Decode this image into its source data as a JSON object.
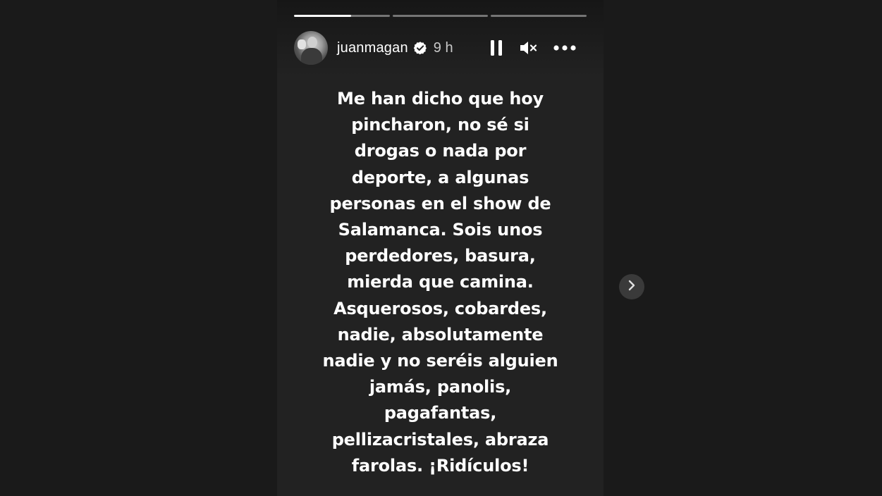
{
  "story": {
    "progress": [
      0.6,
      0,
      0
    ],
    "user": {
      "username": "juanmagan",
      "verified": true,
      "time": "9 h"
    },
    "controls": {
      "pause_icon": "pause-icon",
      "mute_icon": "speaker-muted-icon",
      "more_icon": "more-options-icon"
    },
    "caption": "Me han dicho que hoy\npincharon, no sé si\ndrogas o nada por\ndeporte, a algunas\npersonas en el show de\nSalamanca. Sois unos\nperdedores, basura,\nmierda que camina.\nAsquerosos, cobardes,\nnadie, absolutamente\nnadie y no seréis alguien\njamás, panolis,\npagafantas,\npellizacristales, abraza\nfarolas. ¡Ridículos!"
  },
  "navigation": {
    "next_icon": "chevron-right-icon"
  },
  "colors": {
    "background": "#1a1a1a",
    "story_background": "#222222",
    "text": "#ffffff",
    "verified_badge": "#ffffff"
  }
}
